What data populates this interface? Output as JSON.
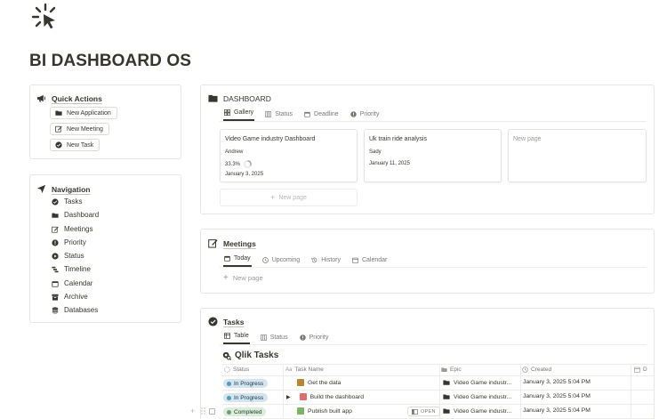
{
  "page": {
    "title": "BI DASHBOARD OS",
    "icon": "cursor-click-icon"
  },
  "quick_actions": {
    "title": "Quick Actions",
    "icon": "megaphone-icon",
    "buttons": [
      {
        "label": "New Application",
        "icon": "folder-icon"
      },
      {
        "label": "New Meeting",
        "icon": "edit-icon"
      },
      {
        "label": "New Task",
        "icon": "check-circle-icon"
      }
    ]
  },
  "navigation": {
    "title": "Navigation",
    "icon": "navigation-arrow-icon",
    "items": [
      {
        "label": "Tasks",
        "icon": "check-circle-icon"
      },
      {
        "label": "Dashboard",
        "icon": "folder-icon"
      },
      {
        "label": "Meetings",
        "icon": "edit-icon"
      },
      {
        "label": "Priority",
        "icon": "alert-circle-icon"
      },
      {
        "label": "Status",
        "icon": "play-circle-icon"
      },
      {
        "label": "Timeline",
        "icon": "timeline-icon"
      },
      {
        "label": "Calendar",
        "icon": "calendar-icon"
      },
      {
        "label": "Archive",
        "icon": "archive-icon"
      },
      {
        "label": "Databases",
        "icon": "database-icon"
      }
    ]
  },
  "dashboard": {
    "title": "DASHBOARD",
    "icon": "folder-icon",
    "tabs": [
      {
        "label": "Gallery",
        "icon": "gallery-icon",
        "active": true
      },
      {
        "label": "Status",
        "icon": "columns-icon"
      },
      {
        "label": "Deadline",
        "icon": "calendar-icon"
      },
      {
        "label": "Priority",
        "icon": "alert-circle-icon"
      }
    ],
    "cards": [
      {
        "title": "Video Game industry Dashboard",
        "person": "Andrew",
        "progress": "33.3%",
        "progress_value": 0.333,
        "date": "January 3, 2025"
      },
      {
        "title": "Uk train ride analysis",
        "person": "Sady",
        "date": "January 11, 2025"
      },
      {
        "title": "New page"
      }
    ],
    "new_page_label": "New page"
  },
  "meetings": {
    "title": "Meetings",
    "icon": "edit-icon",
    "tabs": [
      {
        "label": "Today",
        "icon": "calendar-icon",
        "active": true
      },
      {
        "label": "Upcoming",
        "icon": "clock-icon"
      },
      {
        "label": "History",
        "icon": "history-icon"
      },
      {
        "label": "Calendar",
        "icon": "calendar-outline-icon"
      }
    ],
    "new_page_label": "New page"
  },
  "tasks": {
    "title": "Tasks",
    "icon": "check-circle-icon",
    "tabs": [
      {
        "label": "Table",
        "icon": "table-icon",
        "active": true
      },
      {
        "label": "Status",
        "icon": "columns-icon"
      },
      {
        "label": "Priority",
        "icon": "alert-circle-icon"
      }
    ],
    "view_title": "Qlik Tasks",
    "columns": [
      "Status",
      "Task Name",
      "Epic",
      "Created",
      "D"
    ],
    "open_label": "OPEN",
    "rows": [
      {
        "status": "In Progress",
        "name": "Get the data",
        "epic": "Video Game industr...",
        "created": "January 3, 2025 5:04 PM"
      },
      {
        "status": "In Progress",
        "name": "Build the dashboard",
        "epic": "Video Game industr...",
        "created": "January 3, 2025 5:04 PM"
      },
      {
        "status": "Completed",
        "name": "Publish built app",
        "epic": "Video Game industr...",
        "created": "January 3, 2025 5:04 PM"
      }
    ]
  },
  "colors": {
    "text": "#37352f",
    "muted": "#787774",
    "border": "#e6e6e3",
    "in_progress_bg": "#d3e5ef",
    "in_progress_dot": "#5b97bd",
    "completed_bg": "#dbeddb",
    "completed_dot": "#6c9b7d"
  }
}
